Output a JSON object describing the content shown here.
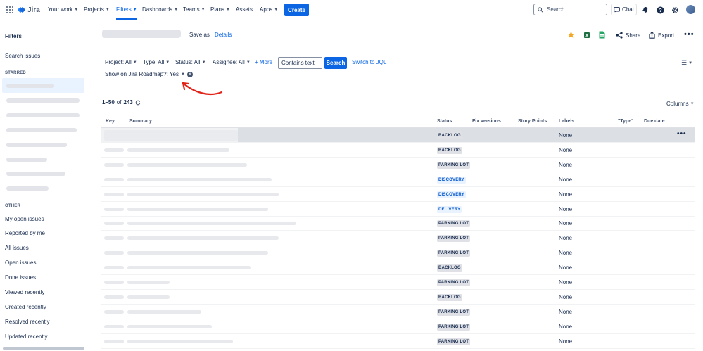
{
  "nav": {
    "product": "Jira",
    "items": [
      {
        "label": "Your work",
        "dropdown": true,
        "active": false
      },
      {
        "label": "Projects",
        "dropdown": true,
        "active": false
      },
      {
        "label": "Filters",
        "dropdown": true,
        "active": true
      },
      {
        "label": "Dashboards",
        "dropdown": true,
        "active": false
      },
      {
        "label": "Teams",
        "dropdown": true,
        "active": false
      },
      {
        "label": "Plans",
        "dropdown": true,
        "active": false
      },
      {
        "label": "Assets",
        "dropdown": false,
        "active": false
      },
      {
        "label": "Apps",
        "dropdown": true,
        "active": false
      }
    ],
    "create_label": "Create",
    "search_placeholder": "Search",
    "chat_label": "Chat",
    "icons": [
      "notifications-icon",
      "help-icon",
      "settings-icon"
    ]
  },
  "sidebar": {
    "title": "Filters",
    "search_issues": "Search issues",
    "starred_heading": "STARRED",
    "other_heading": "OTHER",
    "other_items": [
      "My open issues",
      "Reported by me",
      "All issues",
      "Open issues",
      "Done issues",
      "Viewed recently",
      "Created recently",
      "Resolved recently",
      "Updated recently"
    ]
  },
  "header": {
    "save_as": "Save as",
    "details": "Details",
    "share": "Share",
    "export": "Export"
  },
  "filters": {
    "project": "Project: All",
    "type": "Type: All",
    "status": "Status: All",
    "assignee": "Assignee: All",
    "more": "+ More",
    "contains_text": "Contains text",
    "search_button": "Search",
    "switch_jql": "Switch to JQL",
    "show_on_roadmap": "Show on Jira Roadmap?: Yes"
  },
  "results": {
    "range": "1–50",
    "of": "of",
    "total": "243",
    "columns_label": "Columns"
  },
  "table": {
    "headers": [
      "Key",
      "Summary",
      "Status",
      "Fix versions",
      "Story Points",
      "Labels",
      "\"Type\"",
      "Due date"
    ],
    "rows": [
      {
        "status": "BACKLOG",
        "status_kind": "neutral",
        "labels": "None"
      },
      {
        "status": "BACKLOG",
        "status_kind": "neutral",
        "labels": "None"
      },
      {
        "status": "PARKING LOT",
        "status_kind": "neutral",
        "labels": "None"
      },
      {
        "status": "DISCOVERY",
        "status_kind": "blue",
        "labels": "None"
      },
      {
        "status": "DISCOVERY",
        "status_kind": "blue",
        "labels": "None"
      },
      {
        "status": "DELIVERY",
        "status_kind": "blue",
        "labels": "None"
      },
      {
        "status": "PARKING LOT",
        "status_kind": "neutral",
        "labels": "None"
      },
      {
        "status": "PARKING LOT",
        "status_kind": "neutral",
        "labels": "None"
      },
      {
        "status": "PARKING LOT",
        "status_kind": "neutral",
        "labels": "None"
      },
      {
        "status": "BACKLOG",
        "status_kind": "neutral",
        "labels": "None"
      },
      {
        "status": "PARKING LOT",
        "status_kind": "neutral",
        "labels": "None"
      },
      {
        "status": "BACKLOG",
        "status_kind": "neutral",
        "labels": "None"
      },
      {
        "status": "PARKING LOT",
        "status_kind": "neutral",
        "labels": "None"
      },
      {
        "status": "PARKING LOT",
        "status_kind": "neutral",
        "labels": "None"
      },
      {
        "status": "PARKING LOT",
        "status_kind": "neutral",
        "labels": "None"
      }
    ]
  },
  "colors": {
    "brand_blue": "#0c66e4",
    "lozenge_neutral_bg": "#dfe1e6",
    "lozenge_neutral_fg": "#172b4d",
    "lozenge_blue_bg": "#e9f2ff",
    "lozenge_blue_fg": "#0055cc",
    "annotation_red": "#e2231a"
  }
}
